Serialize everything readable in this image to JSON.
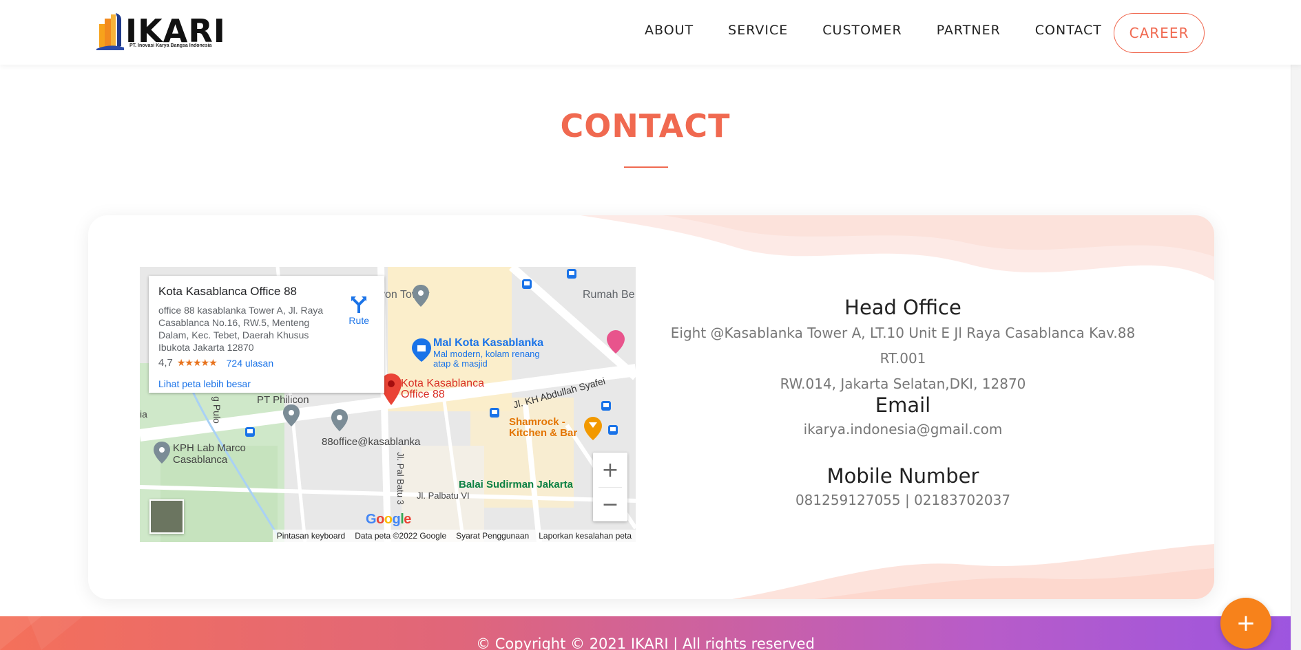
{
  "header": {
    "logo_text": "IKARI",
    "logo_subtitle": "PT. Inovasi Karya Bangsa Indonesia",
    "nav": [
      "ABOUT",
      "SERVICE",
      "CUSTOMER",
      "PARTNER",
      "CONTACT"
    ],
    "career_label": "CAREER"
  },
  "section": {
    "title": "CONTACT"
  },
  "map": {
    "place_title": "Kota Kasablanca Office 88",
    "address": "office 88 kasablanka Tower A, Jl. Raya Casablanca No.16, RW.5, Menteng Dalam, Kec. Tebet, Daerah Khusus Ibukota Jakarta 12870",
    "rating": "4,7",
    "stars": "★★★★★",
    "reviews": "724 ulasan",
    "larger_map": "Lihat peta lebih besar",
    "directions": "Rute",
    "zoom_in": "+",
    "zoom_out": "−",
    "footer": [
      "Pintasan keyboard",
      "Data peta ©2022 Google",
      "Syarat Penggunaan",
      "Laporkan kesalahan peta"
    ],
    "labels": {
      "tower": "yon Tower",
      "rumah": "Rumah Be",
      "mal": "Mal Kota Kasablanka",
      "mal_sub": "Mal modern, kolam renang atap & masjid",
      "pin": "Kota Kasablanca Office 88",
      "street": "Jl. KH Abdullah Syafei",
      "shamrock": "Shamrock - Kitchen & Bar",
      "office": "88office@kasablanka",
      "kph": "KPH Lab Marco Casablanca",
      "balai": "Balai Sudirman Jakarta",
      "palbatu": "Jl. Palbatu VI",
      "palbatu3": "Jl. Pal Batu 3",
      "philicon": "PT Philicon",
      "gpulo": "g Pulo",
      "ia": "ia"
    },
    "google": "Google"
  },
  "contact": {
    "head_office_title": "Head Office",
    "head_office_line1": "Eight @Kasablanka Tower A, LT.10 Unit E Jl Raya Casablanca Kav.88 RT.001",
    "head_office_line2": "RW.014, Jakarta Selatan,DKI, 12870",
    "email_title": "Email",
    "email_value": "ikarya.indonesia@gmail.com",
    "mobile_title": "Mobile Number",
    "mobile_value": "081259127055 | 02183702037"
  },
  "footer": {
    "copyright": "© Copyright © 2021 IKARI | All rights reserved"
  },
  "fab_label": "+",
  "colors": {
    "accent": "#f06950",
    "fab": "#f7821b"
  }
}
